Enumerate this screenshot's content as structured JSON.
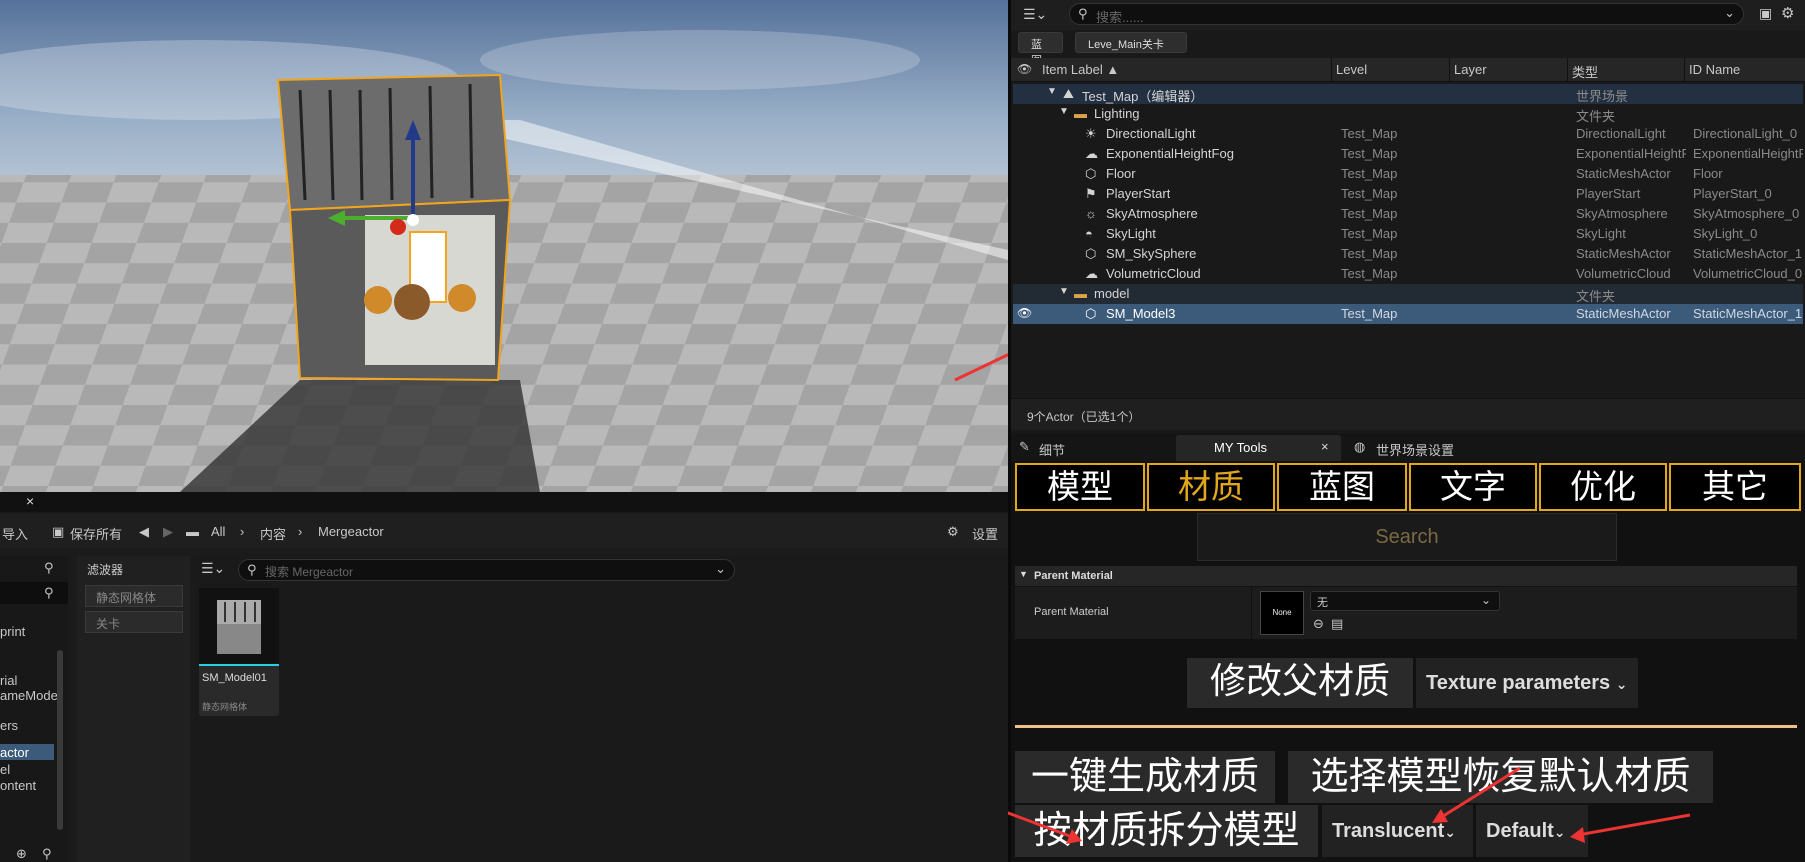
{
  "outliner": {
    "search_placeholder": "搜索......",
    "tags": [
      "蓝图",
      "Leve_Main关卡"
    ],
    "columns": {
      "label": "Item Label ▲",
      "level": "Level",
      "layer": "Layer",
      "type": "类型",
      "id": "ID Name"
    },
    "rows": [
      {
        "label": "Test_Map（编辑器）",
        "level": "",
        "type": "世界场景",
        "id": ""
      },
      {
        "label": "Lighting",
        "level": "",
        "type": "文件夹",
        "id": ""
      },
      {
        "label": "DirectionalLight",
        "level": "Test_Map",
        "type": "DirectionalLight",
        "id": "DirectionalLight_0"
      },
      {
        "label": "ExponentialHeightFog",
        "level": "Test_Map",
        "type": "ExponentialHeightF",
        "id": "ExponentialHeightF"
      },
      {
        "label": "Floor",
        "level": "Test_Map",
        "type": "StaticMeshActor",
        "id": "Floor"
      },
      {
        "label": "PlayerStart",
        "level": "Test_Map",
        "type": "PlayerStart",
        "id": "PlayerStart_0"
      },
      {
        "label": "SkyAtmosphere",
        "level": "Test_Map",
        "type": "SkyAtmosphere",
        "id": "SkyAtmosphere_0"
      },
      {
        "label": "SkyLight",
        "level": "Test_Map",
        "type": "SkyLight",
        "id": "SkyLight_0"
      },
      {
        "label": "SM_SkySphere",
        "level": "Test_Map",
        "type": "StaticMeshActor",
        "id": "StaticMeshActor_1"
      },
      {
        "label": "VolumetricCloud",
        "level": "Test_Map",
        "type": "VolumetricCloud",
        "id": "VolumetricCloud_0"
      },
      {
        "label": "model",
        "level": "",
        "type": "文件夹",
        "id": ""
      },
      {
        "label": "SM_Model3",
        "level": "Test_Map",
        "type": "StaticMeshActor",
        "id": "StaticMeshActor_1"
      }
    ],
    "status": "9个Actor（已选1个）"
  },
  "details": {
    "tabs": {
      "details": "细节",
      "mytools": "MY Tools",
      "world": "世界场景设置"
    },
    "categories": [
      "模型",
      "材质",
      "蓝图",
      "文字",
      "优化",
      "其它"
    ],
    "search_placeholder": "Search",
    "section_title": "Parent Material",
    "prop_label": "Parent Material",
    "thumb_label": "None",
    "prop_value": "无",
    "change_parent_btn": "修改父材质",
    "texture_params": "Texture parameters",
    "gen_btn": "一键生成材质",
    "restore_btn": "选择模型恢复默认材质",
    "split_btn": "按材质拆分模型",
    "dd_translucent": "Translucent",
    "dd_default": "Default",
    "accent": "#e2a71d"
  },
  "content_browser": {
    "import": "导入",
    "save_all": "保存所有",
    "path": [
      "All",
      "内容",
      "Mergeactor"
    ],
    "settings": "设置",
    "filters_title": "滤波器",
    "filter_items": [
      "静态网格体",
      "关卡"
    ],
    "search_placeholder": "搜索 Mergeactor",
    "tree_items": [
      "print",
      "rial",
      "ameMode",
      "ers",
      "actor",
      "el",
      "ontent"
    ],
    "asset": {
      "name": "SM_Model01",
      "type": "静态网格体"
    }
  }
}
